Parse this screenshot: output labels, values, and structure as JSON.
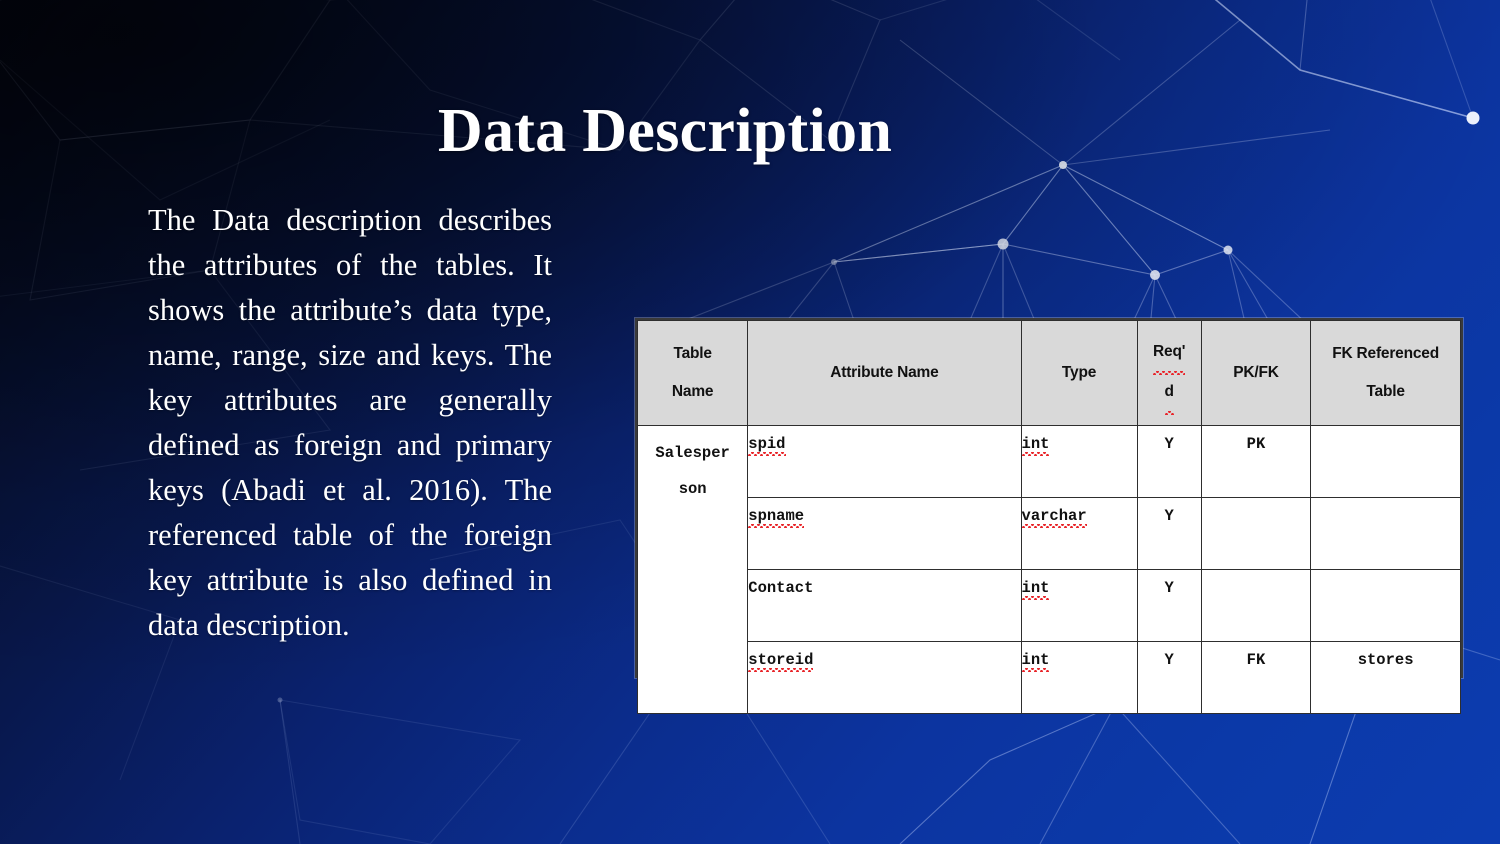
{
  "slide": {
    "title": "Data Description",
    "body": "The Data description describes the attributes of the tables. It shows the attribute’s data type, name, range, size and keys. The key attributes are generally defined as foreign and primary keys (Abadi et al. 2016). The referenced table of the foreign key attribute is also defined in data description.",
    "background": {
      "gradient_from": "#04081c",
      "gradient_to": "#0c3cb0",
      "pattern": "polygonal-network"
    },
    "text_color": "#ffffff"
  },
  "table": {
    "header_bg": "#d9d9d9",
    "border_color": "#2e2e2e",
    "columns": [
      {
        "line1": "Table",
        "line2": "Name"
      },
      {
        "line1": "Attribute Name",
        "line2": ""
      },
      {
        "line1": "Type",
        "line2": ""
      },
      {
        "line1": "Req'",
        "line2": "d"
      },
      {
        "line1": "PK/FK",
        "line2": ""
      },
      {
        "line1": "FK Referenced",
        "line2": "Table"
      }
    ],
    "table_name": {
      "line1": "Salesper",
      "line2": "son"
    },
    "rows": [
      {
        "attribute": "spid",
        "type": "int",
        "required": "Y",
        "key": "PK",
        "fk_referenced_table": ""
      },
      {
        "attribute": "spname",
        "type": "varchar",
        "required": "Y",
        "key": "",
        "fk_referenced_table": ""
      },
      {
        "attribute": "Contact",
        "type": "int",
        "required": "Y",
        "key": "",
        "fk_referenced_table": ""
      },
      {
        "attribute": "storeid",
        "type": "int",
        "required": "Y",
        "key": "FK",
        "fk_referenced_table": "stores"
      }
    ]
  }
}
